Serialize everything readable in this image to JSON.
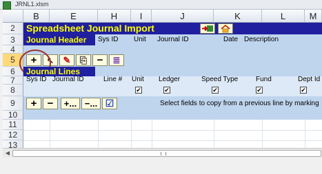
{
  "window": {
    "title": "JRNL1.xlsm"
  },
  "columns": [
    "B",
    "E",
    "H",
    "I",
    "J",
    "K",
    "L",
    "M"
  ],
  "rows": [
    "2",
    "3",
    "4",
    "5",
    "6",
    "7",
    "8",
    "9",
    "10",
    "11",
    "12",
    "13"
  ],
  "title_row": {
    "text": "Spreadsheet Journal Import"
  },
  "header_row": {
    "label": "Journal Header",
    "fields": [
      "Sys ID",
      "Unit",
      "Journal ID",
      "Date",
      "Description"
    ]
  },
  "lines_row": {
    "label": "Journal Lines"
  },
  "line_fields": [
    "Sys ID",
    "Journal ID",
    "Line #",
    "Unit",
    "Ledger",
    "Speed Type",
    "Fund",
    "Dept Id"
  ],
  "row9_hint": "Select fields to copy from a previous line by marking",
  "toolbar5": [
    {
      "name": "add-line-button",
      "glyph": "+"
    },
    {
      "name": "select-cursor-icon",
      "glyph": "↖"
    },
    {
      "name": "edit-pencil-icon",
      "glyph": "✎"
    },
    {
      "name": "copy-icon",
      "glyph": "⎘"
    },
    {
      "name": "remove-line-button",
      "glyph": "−"
    },
    {
      "name": "list-icon",
      "glyph": "≣"
    }
  ],
  "toolbar9": [
    {
      "name": "add-button",
      "glyph": "+"
    },
    {
      "name": "remove-button",
      "glyph": "−"
    },
    {
      "name": "add-more-button",
      "glyph": "+..."
    },
    {
      "name": "remove-more-button",
      "glyph": "−..."
    },
    {
      "name": "check-button",
      "glyph": "☑"
    }
  ],
  "colors": {
    "navy": "#1f1fa0",
    "yellow": "#ffff00",
    "lightblue": "#bfd5ee",
    "band_blue": "#dde9f7"
  }
}
